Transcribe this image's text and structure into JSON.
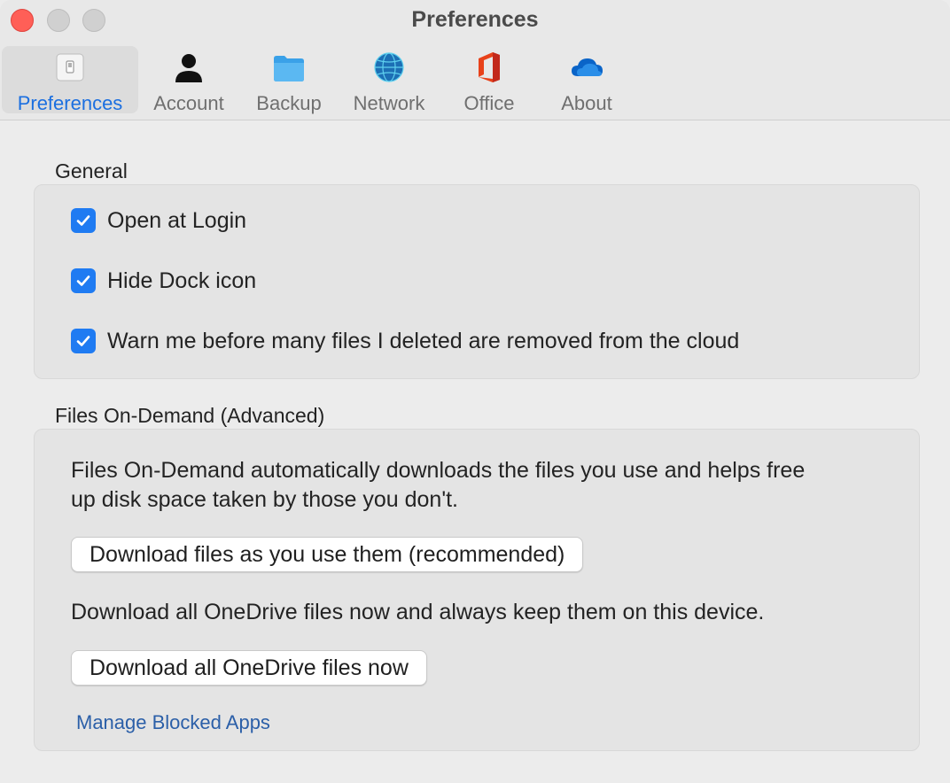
{
  "window": {
    "title": "Preferences"
  },
  "tabs": [
    {
      "label": "Preferences",
      "icon": "switch-icon",
      "active": true
    },
    {
      "label": "Account",
      "icon": "person-icon",
      "active": false
    },
    {
      "label": "Backup",
      "icon": "folder-icon",
      "active": false
    },
    {
      "label": "Network",
      "icon": "globe-icon",
      "active": false
    },
    {
      "label": "Office",
      "icon": "office-icon",
      "active": false
    },
    {
      "label": "About",
      "icon": "cloud-icon",
      "active": false
    }
  ],
  "general": {
    "heading": "General",
    "options": [
      {
        "label": "Open at Login",
        "checked": true
      },
      {
        "label": "Hide Dock icon",
        "checked": true
      },
      {
        "label": "Warn me before many files I deleted are removed from the cloud",
        "checked": true
      }
    ]
  },
  "files_on_demand": {
    "heading": "Files On-Demand (Advanced)",
    "description_line1": "Files On-Demand automatically downloads the files you use and helps free",
    "description_line2": "up disk space taken by those you don't.",
    "download_as_used_button": "Download files as you use them (recommended)",
    "download_all_description": "Download all OneDrive files now and always keep them on this device.",
    "download_all_button": "Download all OneDrive files now",
    "manage_blocked_apps_link": "Manage Blocked Apps"
  },
  "colors": {
    "accent": "#1f7bf2",
    "active_tab_text": "#1b6fe0",
    "link": "#2b5fa8",
    "close_button": "#ff5f57"
  }
}
